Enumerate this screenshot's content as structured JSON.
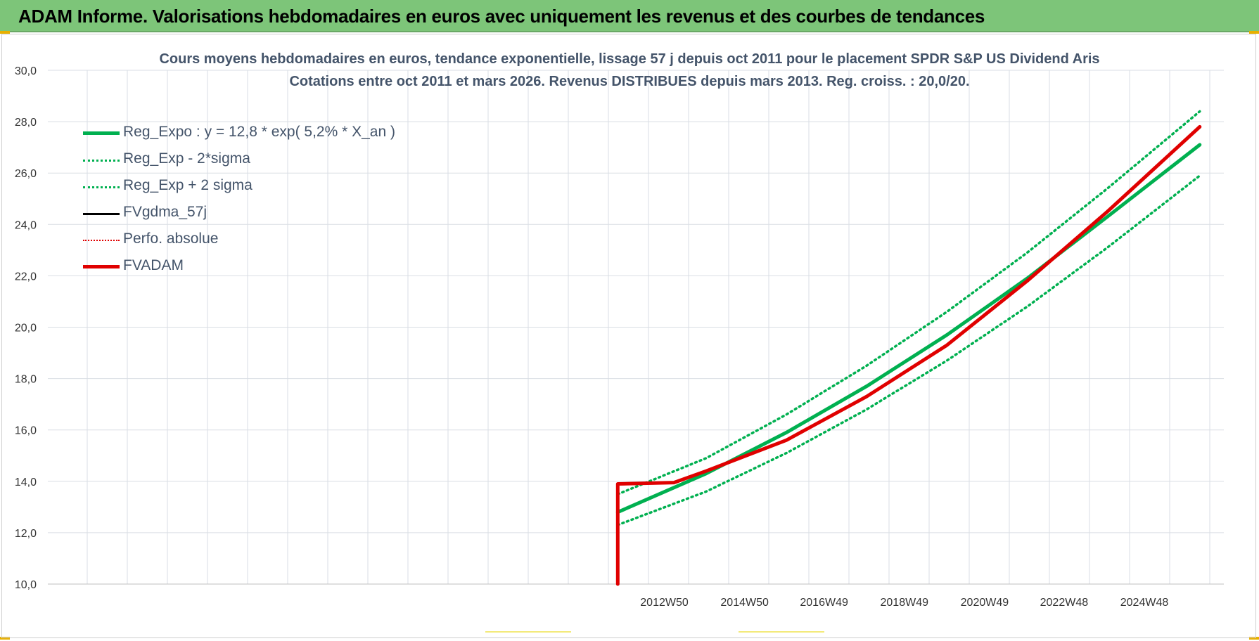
{
  "banner": {
    "title": "ADAM Informe. Valorisations hebdomadaires en euros avec uniquement les revenus et des courbes de tendances"
  },
  "colors": {
    "banner_bg": "#7dc579",
    "trend_green": "#00b050",
    "fvadam_red": "#e00000",
    "fvgdma_black": "#000000",
    "grid": "#d9dee4",
    "text": "#44546a"
  },
  "chart_data": {
    "type": "line",
    "title": "Cours moyens hebdomadaires en euros, tendance exponentielle, lissage 57 j depuis oct 2011 pour le placement SPDR S&P US Dividend Aris",
    "subtitle": "Cotations entre oct 2011 et mars 2026. Revenus DISTRIBUES depuis mars 2013. Reg. croiss. : 20,0/20.",
    "xlabel": "",
    "ylabel": "",
    "ylim": [
      10.0,
      30.0
    ],
    "y_ticks": [
      "10,0",
      "12,0",
      "14,0",
      "16,0",
      "18,0",
      "20,0",
      "22,0",
      "24,0",
      "26,0",
      "28,0",
      "30,0"
    ],
    "x_tick_labels": [
      "2012W50",
      "2014W50",
      "2016W49",
      "2018W49",
      "2020W49",
      "2022W48",
      "2024W48"
    ],
    "x_tick_years": [
      2012.96,
      2014.96,
      2016.94,
      2018.94,
      2020.94,
      2022.92,
      2024.92
    ],
    "xlim": [
      1997.6,
      2026.9
    ],
    "grid": true,
    "legend_position": "top-left",
    "legend": [
      {
        "label": "Reg_Expo : y = 12,8 * exp( 5,2% *  X_an )",
        "style": "solid-thick",
        "color": "#00b050"
      },
      {
        "label": "Reg_Exp - 2*sigma",
        "style": "dotted",
        "color": "#00b050"
      },
      {
        "label": "Reg_Exp + 2 sigma",
        "style": "dotted",
        "color": "#00b050"
      },
      {
        "label": "FVgdma_57j",
        "style": "solid",
        "color": "#000000"
      },
      {
        "label": "Perfo. absolue",
        "style": "dotted-thin",
        "color": "#e00000"
      },
      {
        "label": "FVADAM",
        "style": "solid-thick",
        "color": "#e00000"
      }
    ],
    "series": [
      {
        "name": "Reg_Expo : y = 12,8 * exp( 5,2% *  X_an )",
        "x": [
          2011.8,
          2014.0,
          2016.0,
          2018.0,
          2020.0,
          2022.0,
          2024.0,
          2026.3
        ],
        "values": [
          12.8,
          14.3,
          15.9,
          17.7,
          19.7,
          21.9,
          24.3,
          27.1
        ]
      },
      {
        "name": "Reg_Exp - 2*sigma",
        "x": [
          2011.8,
          2014.0,
          2016.0,
          2018.0,
          2020.0,
          2022.0,
          2024.0,
          2026.3
        ],
        "values": [
          12.3,
          13.6,
          15.1,
          16.8,
          18.7,
          20.8,
          23.1,
          25.9
        ]
      },
      {
        "name": "Reg_Exp + 2 sigma",
        "x": [
          2011.8,
          2014.0,
          2016.0,
          2018.0,
          2020.0,
          2022.0,
          2024.0,
          2026.3
        ],
        "values": [
          13.5,
          14.9,
          16.6,
          18.5,
          20.6,
          22.9,
          25.4,
          28.4
        ]
      },
      {
        "name": "FVgdma_57j",
        "x": [
          2011.8,
          2013.2,
          2014.0,
          2016.0,
          2018.0,
          2020.0,
          2022.0,
          2024.0,
          2026.3
        ],
        "values": [
          13.9,
          13.95,
          14.4,
          15.6,
          17.3,
          19.3,
          21.8,
          24.5,
          27.8
        ]
      },
      {
        "name": "FVADAM",
        "x": [
          2011.8,
          2011.8,
          2013.2,
          2014.0,
          2016.0,
          2018.0,
          2020.0,
          2022.0,
          2024.0,
          2026.3
        ],
        "values": [
          10.0,
          13.9,
          13.95,
          14.4,
          15.6,
          17.3,
          19.3,
          21.8,
          24.5,
          27.8
        ]
      }
    ]
  }
}
